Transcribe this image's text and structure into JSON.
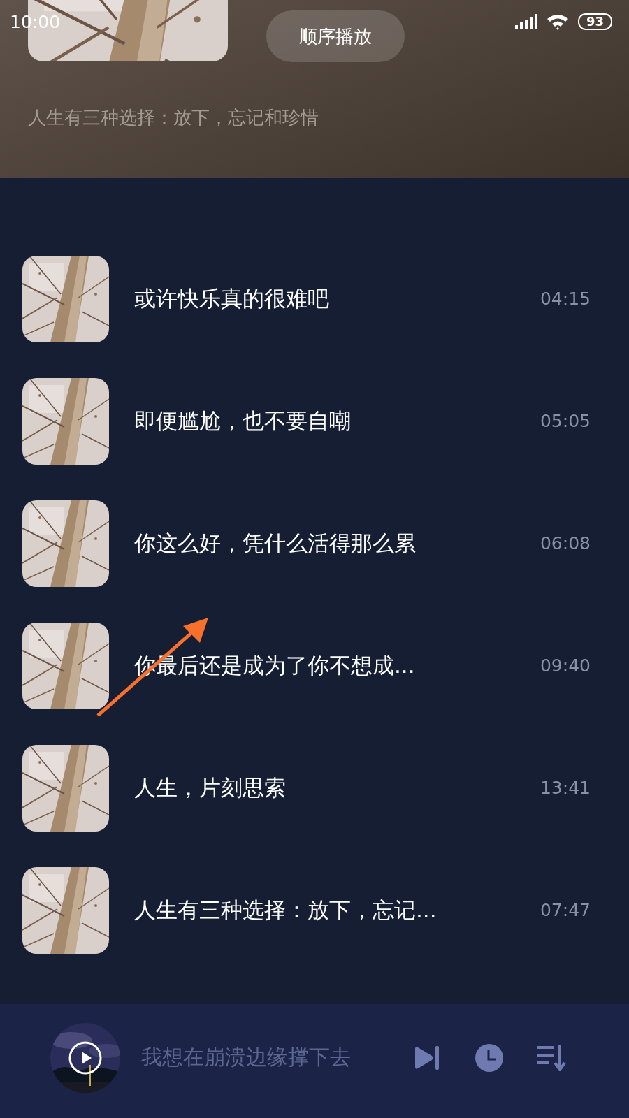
{
  "status_bar": {
    "time": "10:00",
    "battery": "93"
  },
  "header": {
    "play_mode_button": "顺序播放",
    "description": "人生有三种选择：放下，忘记和珍惜"
  },
  "songs": [
    {
      "title": "或许快乐真的很难吧",
      "duration": "04:15"
    },
    {
      "title": "即便尴尬，也不要自嘲",
      "duration": "05:05"
    },
    {
      "title": "你这么好，凭什么活得那么累",
      "duration": "06:08"
    },
    {
      "title": "你最后还是成为了你不想成...",
      "duration": "09:40"
    },
    {
      "title": "人生，片刻思索",
      "duration": "13:41"
    },
    {
      "title": "人生有三种选择：放下，忘记...",
      "duration": "07:47"
    }
  ],
  "mini_player": {
    "title": "我想在崩溃边缘撑下去"
  }
}
